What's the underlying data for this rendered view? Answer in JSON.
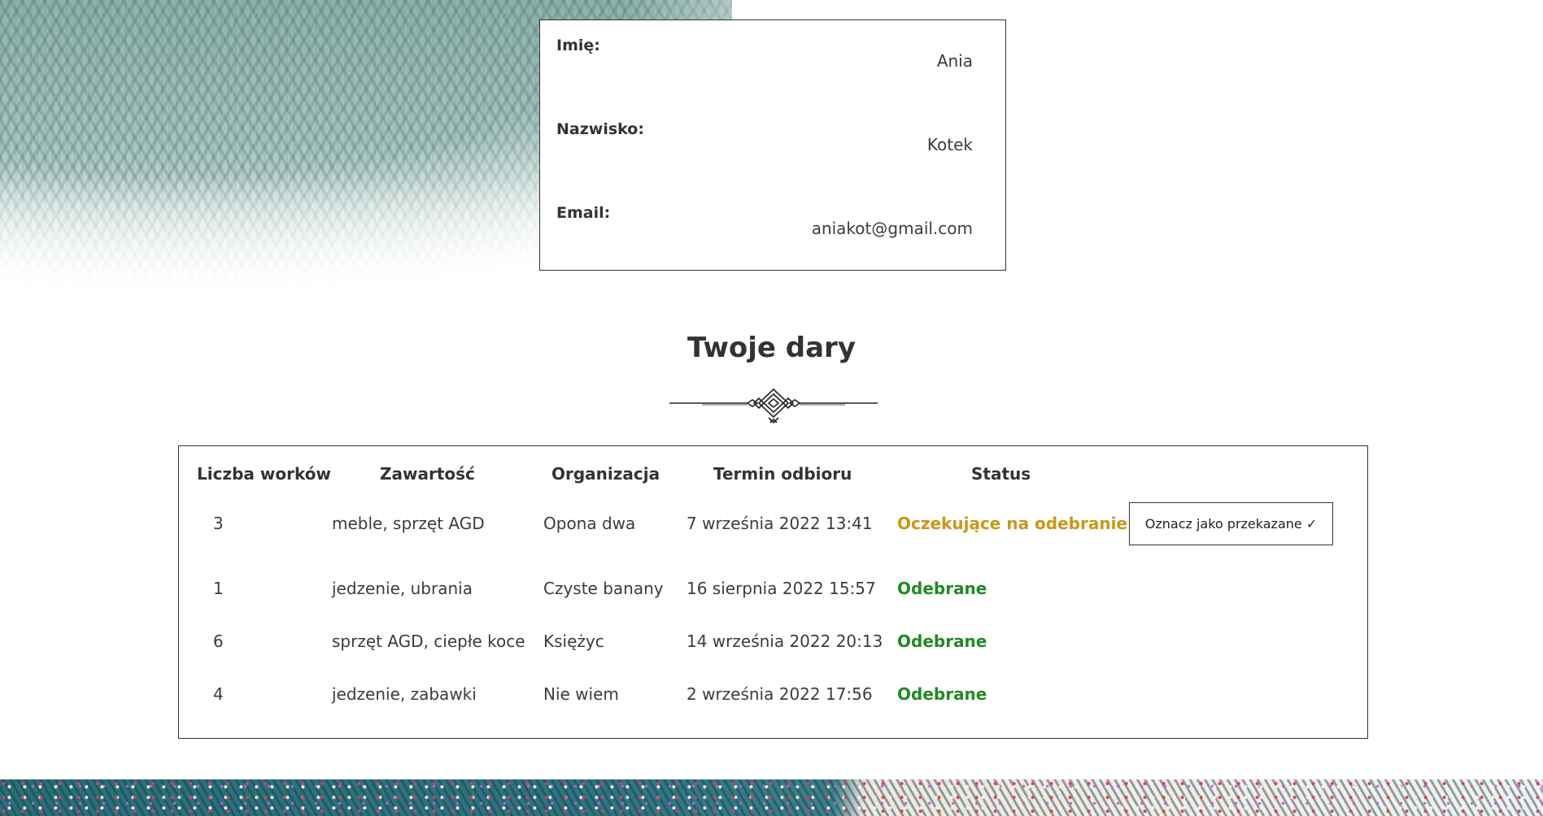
{
  "profile": {
    "first_name_label": "Imię:",
    "first_name_value": "Ania",
    "last_name_label": "Nazwisko:",
    "last_name_value": "Kotek",
    "email_label": "Email:",
    "email_value": "aniakot@gmail.com"
  },
  "donations": {
    "title": "Twoje dary",
    "columns": [
      "Liczba worków",
      "Zawartość",
      "Organizacja",
      "Termin odbioru",
      "Status"
    ],
    "rows": [
      {
        "bags": "3",
        "content": "meble, sprzęt AGD",
        "organization": "Opona dwa",
        "pickup": "7 września 2022 13:41",
        "status": "Oczekujące na odebranie",
        "status_kind": "pending",
        "action_label": "Oznacz jako przekazane ✓"
      },
      {
        "bags": "1",
        "content": "jedzenie, ubrania",
        "organization": "Czyste banany",
        "pickup": "16 sierpnia 2022 15:57",
        "status": "Odebrane",
        "status_kind": "done"
      },
      {
        "bags": "6",
        "content": "sprzęt AGD, ciepłe koce",
        "organization": "Księżyc",
        "pickup": "14 września 2022 20:13",
        "status": "Odebrane",
        "status_kind": "done"
      },
      {
        "bags": "4",
        "content": "jedzenie, zabawki",
        "organization": "Nie wiem",
        "pickup": "2 września 2022 17:56",
        "status": "Odebrane",
        "status_kind": "done"
      }
    ]
  },
  "colors": {
    "status_pending": "#c9971a",
    "status_done": "#218a21",
    "border": "#333333",
    "text": "#3c3c3c"
  },
  "icons": {
    "ornament": "decorative-divider-icon",
    "check": "check-icon"
  }
}
